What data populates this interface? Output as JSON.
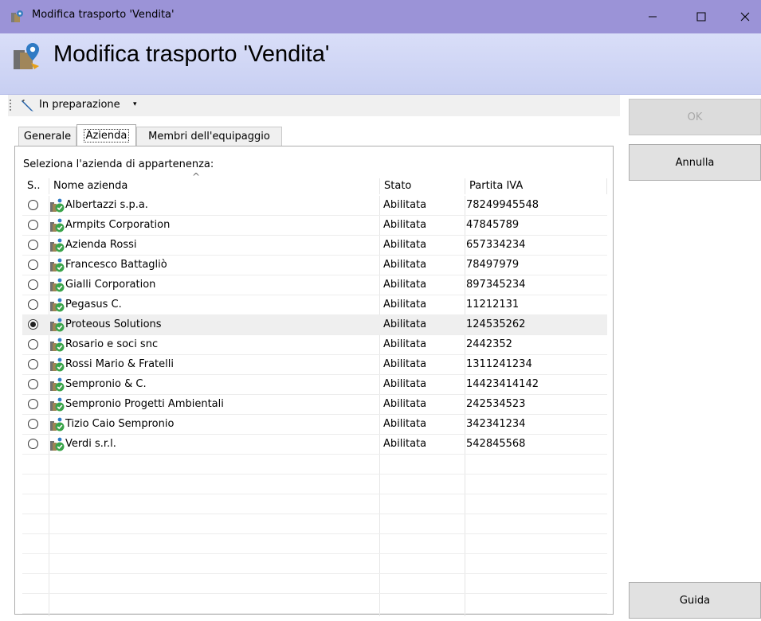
{
  "window": {
    "title": "Modifica trasporto 'Vendita'",
    "controls": {
      "minimize": "—",
      "maximize": "☐",
      "close": "✕"
    }
  },
  "header": {
    "heading": "Modifica trasporto 'Vendita'"
  },
  "toolbar": {
    "status": "In preparazione",
    "caret": "▾"
  },
  "tabs": [
    {
      "label": "Generale"
    },
    {
      "label": "Azienda"
    },
    {
      "label": "Membri dell'equipaggio"
    }
  ],
  "panel": {
    "caption": "Seleziona l'azienda di appartenenza:"
  },
  "table": {
    "columns": {
      "select": "S..",
      "name": "Nome azienda",
      "status": "Stato",
      "vat": "Partita IVA"
    },
    "sort_indicator": "^",
    "rows": [
      {
        "name": "Albertazzi s.p.a.",
        "status": "Abilitata",
        "vat": "78249945548",
        "selected": false
      },
      {
        "name": "Armpits Corporation",
        "status": "Abilitata",
        "vat": "47845789",
        "selected": false
      },
      {
        "name": "Azienda Rossi",
        "status": "Abilitata",
        "vat": "657334234",
        "selected": false
      },
      {
        "name": "Francesco Battagliò",
        "status": "Abilitata",
        "vat": "78497979",
        "selected": false
      },
      {
        "name": "Gialli Corporation",
        "status": "Abilitata",
        "vat": "897345234",
        "selected": false
      },
      {
        "name": "Pegasus C.",
        "status": "Abilitata",
        "vat": "11212131",
        "selected": false
      },
      {
        "name": "Proteous Solutions",
        "status": "Abilitata",
        "vat": "124535262",
        "selected": true
      },
      {
        "name": "Rosario e soci snc",
        "status": "Abilitata",
        "vat": "2442352",
        "selected": false
      },
      {
        "name": "Rossi Mario & Fratelli",
        "status": "Abilitata",
        "vat": "1311241234",
        "selected": false
      },
      {
        "name": "Sempronio & C.",
        "status": "Abilitata",
        "vat": "14423414142",
        "selected": false
      },
      {
        "name": "Sempronio Progetti Ambientali",
        "status": "Abilitata",
        "vat": "242534523",
        "selected": false
      },
      {
        "name": "Tizio Caio Sempronio",
        "status": "Abilitata",
        "vat": "342341234",
        "selected": false
      },
      {
        "name": "Verdi s.r.l.",
        "status": "Abilitata",
        "vat": "542845568",
        "selected": false
      }
    ],
    "empty_rows": 8
  },
  "buttons": {
    "ok": "OK",
    "cancel": "Annulla",
    "help": "Guida"
  },
  "colors": {
    "titlebar": "#9b93d7",
    "header_gradient_top": "#d9def8",
    "header_gradient_bottom": "#c8cff2",
    "row_selected": "#efefef"
  },
  "icons": [
    "app-transport-icon",
    "pencil-icon",
    "company-enabled-icon"
  ]
}
